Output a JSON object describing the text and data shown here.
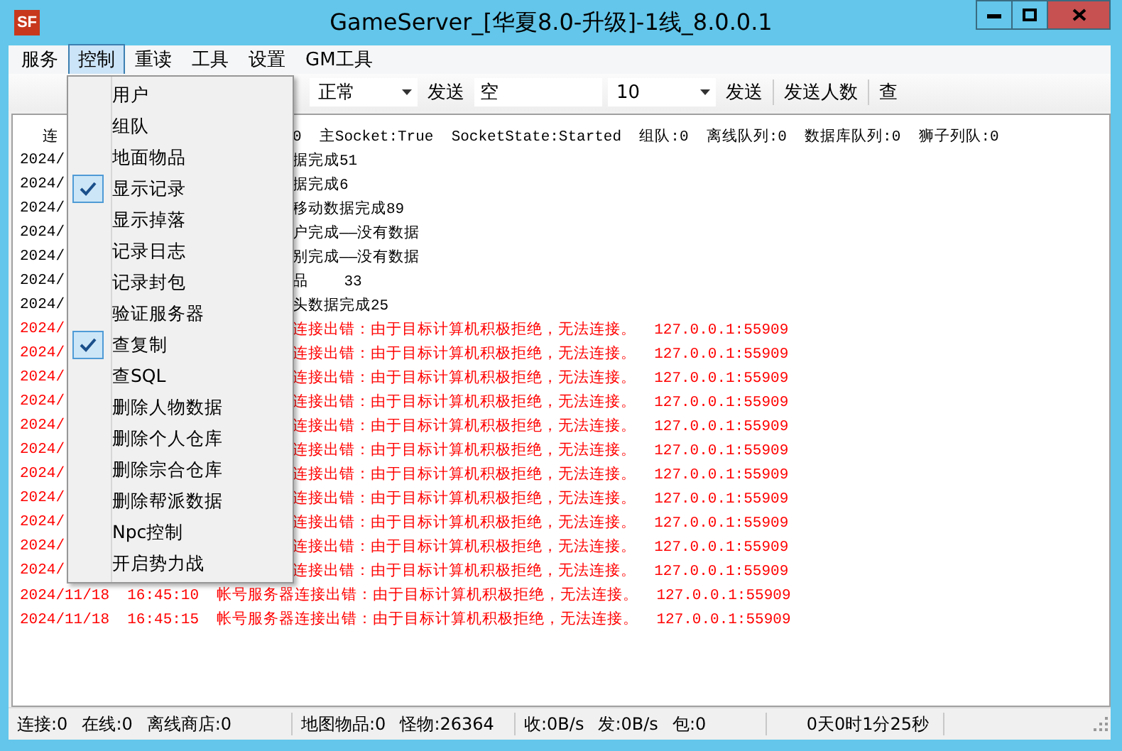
{
  "window": {
    "icon": "SF",
    "title": "GameServer_[华夏8.0-升级]-1线_8.0.0.1",
    "controls": [
      {
        "kind": "minimize"
      },
      {
        "kind": "maximize"
      },
      {
        "kind": "close"
      }
    ]
  },
  "menubar": [
    {
      "label": "服务",
      "selected": false
    },
    {
      "label": "控制",
      "selected": true
    },
    {
      "label": "重读",
      "selected": false
    },
    {
      "label": "工具",
      "selected": false
    },
    {
      "label": "设置",
      "selected": false
    },
    {
      "label": "GM工具",
      "selected": false
    }
  ],
  "toolbar": [
    {
      "kind": "combo",
      "value": "正常"
    },
    {
      "kind": "button",
      "label": "发送"
    },
    {
      "kind": "field",
      "value": "空"
    },
    {
      "kind": "combo",
      "value": "10"
    },
    {
      "kind": "button",
      "label": "发送"
    },
    {
      "kind": "separator"
    },
    {
      "kind": "button",
      "label": "发送人数"
    },
    {
      "kind": "separator"
    },
    {
      "kind": "button",
      "label": "查"
    }
  ],
  "dropdown": [
    {
      "label": "用户",
      "checked": false
    },
    {
      "label": "组队",
      "checked": false
    },
    {
      "label": "地面物品",
      "checked": false
    },
    {
      "label": "显示记录",
      "checked": true
    },
    {
      "label": "显示掉落",
      "checked": false
    },
    {
      "label": "记录日志",
      "checked": false
    },
    {
      "label": "记录封包",
      "checked": false
    },
    {
      "label": "验证服务器",
      "checked": false
    },
    {
      "label": "查复制",
      "checked": true
    },
    {
      "label": "查SQL",
      "checked": false
    },
    {
      "label": "删除人物数据",
      "checked": false
    },
    {
      "label": "删除个人仓库",
      "checked": false
    },
    {
      "label": "删除宗合仓库",
      "checked": false
    },
    {
      "label": "删除帮派数据",
      "checked": false
    },
    {
      "label": "Npc控制",
      "checked": false
    },
    {
      "label": "开启势力战",
      "checked": false
    }
  ],
  "log": [
    {
      "kind": "status",
      "left": "连",
      "right": "0  主Socket:True  SocketState:Started  组队:0  离线队列:0  数据库队列:0  狮子列队:0"
    },
    {
      "kind": "info",
      "left": "2024/",
      "right": "据完成51"
    },
    {
      "kind": "info",
      "left": "2024/",
      "right": "据完成6"
    },
    {
      "kind": "info",
      "left": "2024/",
      "right": "移动数据完成89"
    },
    {
      "kind": "info",
      "left": "2024/",
      "right": "户完成——没有数据"
    },
    {
      "kind": "info",
      "left": "2024/",
      "right": "别完成——没有数据"
    },
    {
      "kind": "info",
      "left": "2024/",
      "right": "品    33"
    },
    {
      "kind": "info",
      "left": "2024/",
      "right": "头数据完成25"
    },
    {
      "kind": "error",
      "left": "2024/",
      "right": "连接出错：由于目标计算机积极拒绝，无法连接。  127.0.0.1:55909"
    },
    {
      "kind": "error",
      "left": "2024/",
      "right": "连接出错：由于目标计算机积极拒绝，无法连接。  127.0.0.1:55909"
    },
    {
      "kind": "error",
      "left": "2024/",
      "right": "连接出错：由于目标计算机积极拒绝，无法连接。  127.0.0.1:55909"
    },
    {
      "kind": "error",
      "left": "2024/",
      "right": "连接出错：由于目标计算机积极拒绝，无法连接。  127.0.0.1:55909"
    },
    {
      "kind": "error",
      "left": "2024/",
      "right": "连接出错：由于目标计算机积极拒绝，无法连接。  127.0.0.1:55909"
    },
    {
      "kind": "error",
      "left": "2024/",
      "right": "连接出错：由于目标计算机积极拒绝，无法连接。  127.0.0.1:55909"
    },
    {
      "kind": "error",
      "left": "2024/",
      "right": "连接出错：由于目标计算机积极拒绝，无法连接。  127.0.0.1:55909"
    },
    {
      "kind": "error",
      "left": "2024/",
      "right": "连接出错：由于目标计算机积极拒绝，无法连接。  127.0.0.1:55909"
    },
    {
      "kind": "error",
      "left": "2024/",
      "right": "连接出错：由于目标计算机积极拒绝，无法连接。  127.0.0.1:55909"
    },
    {
      "kind": "error",
      "left": "2024/",
      "right": "连接出错：由于目标计算机积极拒绝，无法连接。  127.0.0.1:55909"
    },
    {
      "kind": "error",
      "left": "2024/",
      "right": "连接出错：由于目标计算机积极拒绝，无法连接。  127.0.0.1:55909"
    },
    {
      "kind": "error",
      "text": "2024/11/18  16:45:10  帐号服务器连接出错：由于目标计算机积极拒绝，无法连接。  127.0.0.1:55909"
    },
    {
      "kind": "error",
      "text": "2024/11/18  16:45:15  帐号服务器连接出错：由于目标计算机积极拒绝，无法连接。  127.0.0.1:55909"
    }
  ],
  "status_bar": [
    [
      "连接:0",
      "在线:0",
      "离线商店:0"
    ],
    [
      "地图物品:0",
      "怪物:26364"
    ],
    [
      "收:0B/s",
      "发:0B/s",
      "包:0"
    ],
    [
      "0天0时1分25秒"
    ]
  ]
}
